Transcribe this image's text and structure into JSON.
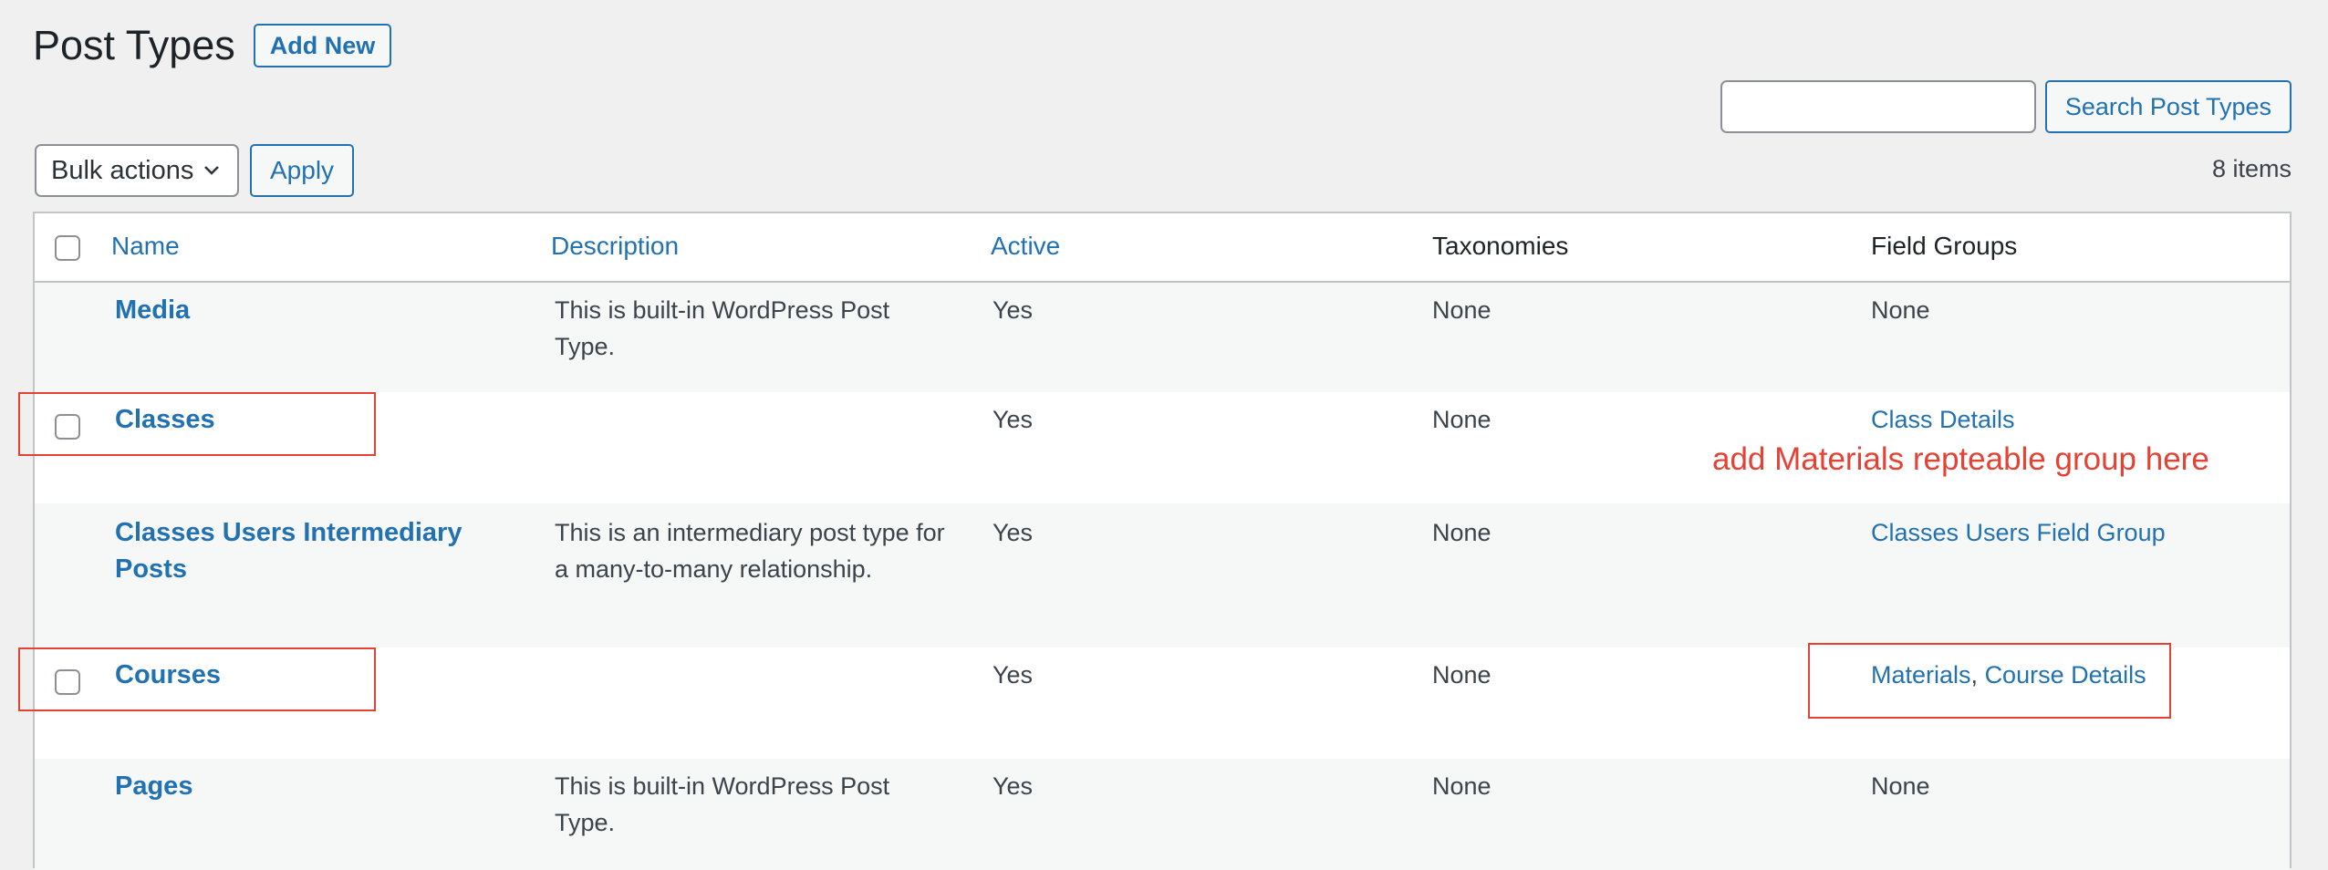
{
  "header": {
    "title": "Post Types",
    "add_new_label": "Add New"
  },
  "search": {
    "placeholder": "",
    "button_label": "Search Post Types"
  },
  "bulk": {
    "selected": "Bulk actions",
    "apply_label": "Apply"
  },
  "item_count": "8 items",
  "table": {
    "columns": [
      "Name",
      "Description",
      "Active",
      "Taxonomies",
      "Field Groups"
    ],
    "rows": [
      {
        "name": "Media",
        "description_line1": "This is built-in WordPress Post",
        "description_line2": "Type.",
        "active": "Yes",
        "taxonomies": "None",
        "field_groups": "None"
      },
      {
        "name": "Classes",
        "active": "Yes",
        "taxonomies": "None",
        "field_groups": "Class Details"
      },
      {
        "name_line1": "Classes Users Intermediary",
        "name_line2": "Posts",
        "description_line1": "This is an intermediary post type for",
        "description_line2": "a many-to-many relationship.",
        "active": "Yes",
        "taxonomies": "None",
        "field_groups": "Classes Users Field Group"
      },
      {
        "name": "Courses",
        "active": "Yes",
        "taxonomies": "None",
        "field_group_1": "Materials",
        "field_group_sep": ",",
        "field_group_2": "Course Details"
      },
      {
        "name": "Pages",
        "description_line1": "This is built-in WordPress Post",
        "description_line2": "Type.",
        "active": "Yes",
        "taxonomies": "None",
        "field_groups": "None"
      }
    ]
  },
  "annotation": {
    "text": "add Materials repteable group here",
    "color": "#e34234"
  },
  "colors": {
    "link": "#2271b1",
    "background": "#f0f0f1",
    "alt_row": "#f6f7f7"
  }
}
